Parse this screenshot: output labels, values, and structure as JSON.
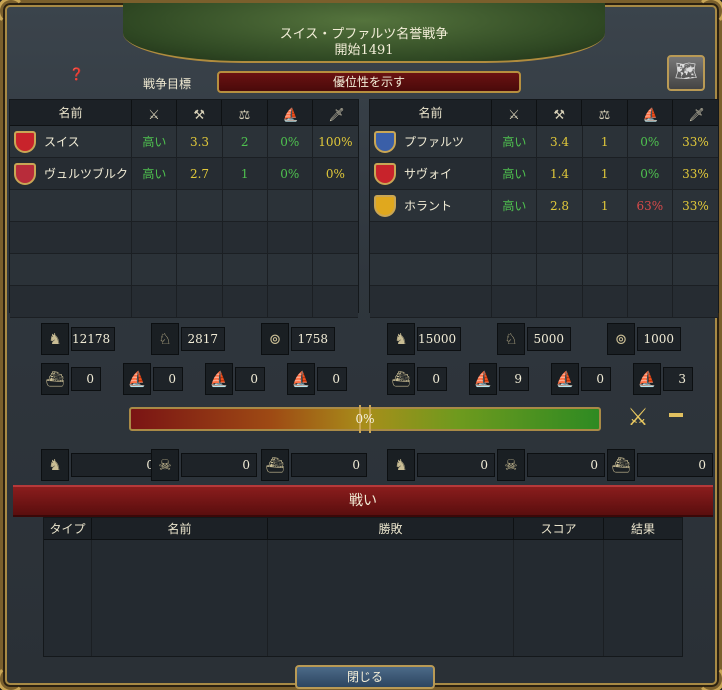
{
  "window": {
    "title_line1": "スイス・プファルツ名誉戦争",
    "title_line2": "開始1491",
    "goal_label": "戦争目標",
    "goal_value": "優位性を示す"
  },
  "participant_headers": {
    "name": "名前",
    "icons": [
      "crossed-swords-icon",
      "crossed-axes-icon",
      "scales-icon",
      "fleet-icon",
      "sword-icon"
    ]
  },
  "attackers": [
    {
      "name": "スイス",
      "c1": "高い",
      "c2": "3.3",
      "c3": "2",
      "c4": "0%",
      "c5": "100%",
      "flag_color": "#c8232b",
      "c5_color": "y"
    },
    {
      "name": "ヴュルツブルク",
      "c1": "高い",
      "c2": "2.7",
      "c3": "1",
      "c4": "0%",
      "c5": "0%",
      "flag_color": "#b82c3a",
      "c5_color": "y"
    }
  ],
  "defenders": [
    {
      "name": "プファルツ",
      "c1": "高い",
      "c2": "3.4",
      "c3": "1",
      "c4": "0%",
      "c5": "33%",
      "flag_color": "#3a5fa8",
      "c4_color": "g"
    },
    {
      "name": "サヴォイ",
      "c1": "高い",
      "c2": "1.4",
      "c3": "1",
      "c4": "0%",
      "c5": "33%",
      "flag_color": "#c8232b",
      "c4_color": "g"
    },
    {
      "name": "ホラント",
      "c1": "高い",
      "c2": "2.8",
      "c3": "1",
      "c4": "63%",
      "c5": "33%",
      "flag_color": "#e0a81e",
      "c4_color": "r"
    }
  ],
  "attacker_army": {
    "infantry": "12178",
    "cavalry": "2817",
    "artillery": "1758"
  },
  "defender_army": {
    "infantry": "15000",
    "cavalry": "5000",
    "artillery": "1000"
  },
  "attacker_navy": {
    "heavy": "0",
    "light": "0",
    "galley": "0",
    "transport": "0"
  },
  "defender_navy": {
    "heavy": "0",
    "light": "9",
    "galley": "0",
    "transport": "3"
  },
  "attacker_losses": {
    "land": "0",
    "attrition": "0",
    "naval": "0"
  },
  "defender_losses": {
    "land": "0",
    "attrition": "0",
    "naval": "0"
  },
  "war_score": {
    "value": "0%",
    "progress": 0.5
  },
  "battles": {
    "title": "戦い",
    "headers": [
      "タイプ",
      "名前",
      "勝敗",
      "スコア",
      "結果"
    ]
  },
  "close_label": "閉じる"
}
